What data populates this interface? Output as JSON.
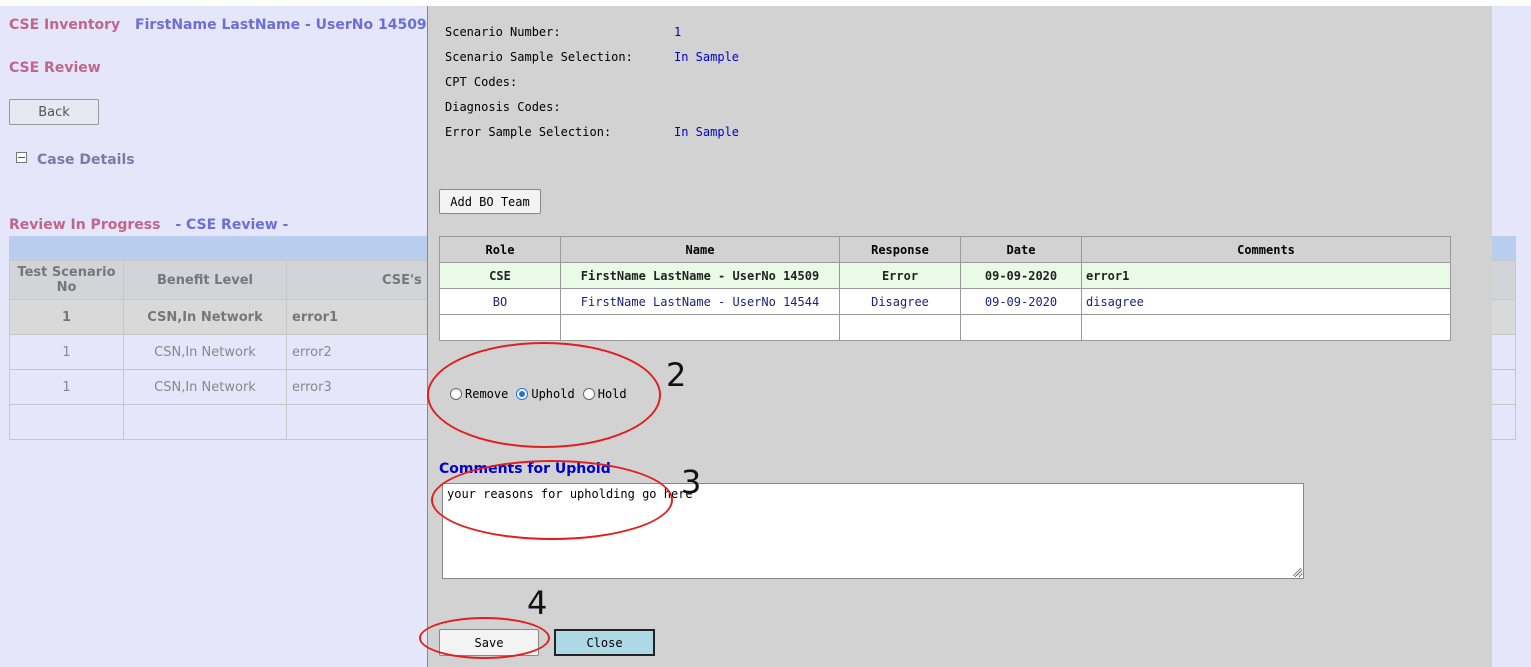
{
  "background": {
    "app_title": "CSE Inventory",
    "user_title": "FirstName LastName - UserNo 14509",
    "subtitle": "CSE Review",
    "back_label": "Back",
    "case_details_label": "Case Details",
    "review_status": "Review In Progress",
    "review_section": "- CSE Review -",
    "table_headers": [
      "Test Scenario No",
      "Benefit Level",
      "CSE's"
    ],
    "rows": [
      {
        "no": "1",
        "level": "CSN,In Network",
        "cse": "error1"
      },
      {
        "no": "1",
        "level": "CSN,In Network",
        "cse": "error2"
      },
      {
        "no": "1",
        "level": "CSN,In Network",
        "cse": "error3"
      }
    ]
  },
  "modal": {
    "info": [
      {
        "label": "Scenario Number:",
        "value": "1"
      },
      {
        "label": "Scenario Sample Selection:",
        "value": "In Sample"
      },
      {
        "label": "CPT Codes:",
        "value": ""
      },
      {
        "label": "Diagnosis Codes:",
        "value": ""
      },
      {
        "label": "Error Sample Selection:",
        "value": "In Sample"
      }
    ],
    "add_bo_team_label": "Add BO Team",
    "grid_headers": [
      "Role",
      "Name",
      "Response",
      "Date",
      "Comments"
    ],
    "grid_rows": [
      {
        "role": "CSE",
        "name": "FirstName LastName - UserNo 14509",
        "response": "Error",
        "date": "09-09-2020",
        "comments": "error1"
      },
      {
        "role": "BO",
        "name": "FirstName LastName - UserNo 14544",
        "response": "Disagree",
        "date": "09-09-2020",
        "comments": "disagree"
      }
    ],
    "decision_options": [
      {
        "label": "Remove",
        "selected": false
      },
      {
        "label": "Uphold",
        "selected": true
      },
      {
        "label": "Hold",
        "selected": false
      }
    ],
    "comments_label": "Comments for Uphold",
    "comments_value": "your reasons for upholding go here",
    "save_label": "Save",
    "close_label": "Close"
  },
  "annotations": [
    "2",
    "3",
    "4"
  ],
  "colors": {
    "annotation_ring": "#e02020",
    "link_blue": "#0000cc",
    "close_button": "#add8e6"
  }
}
